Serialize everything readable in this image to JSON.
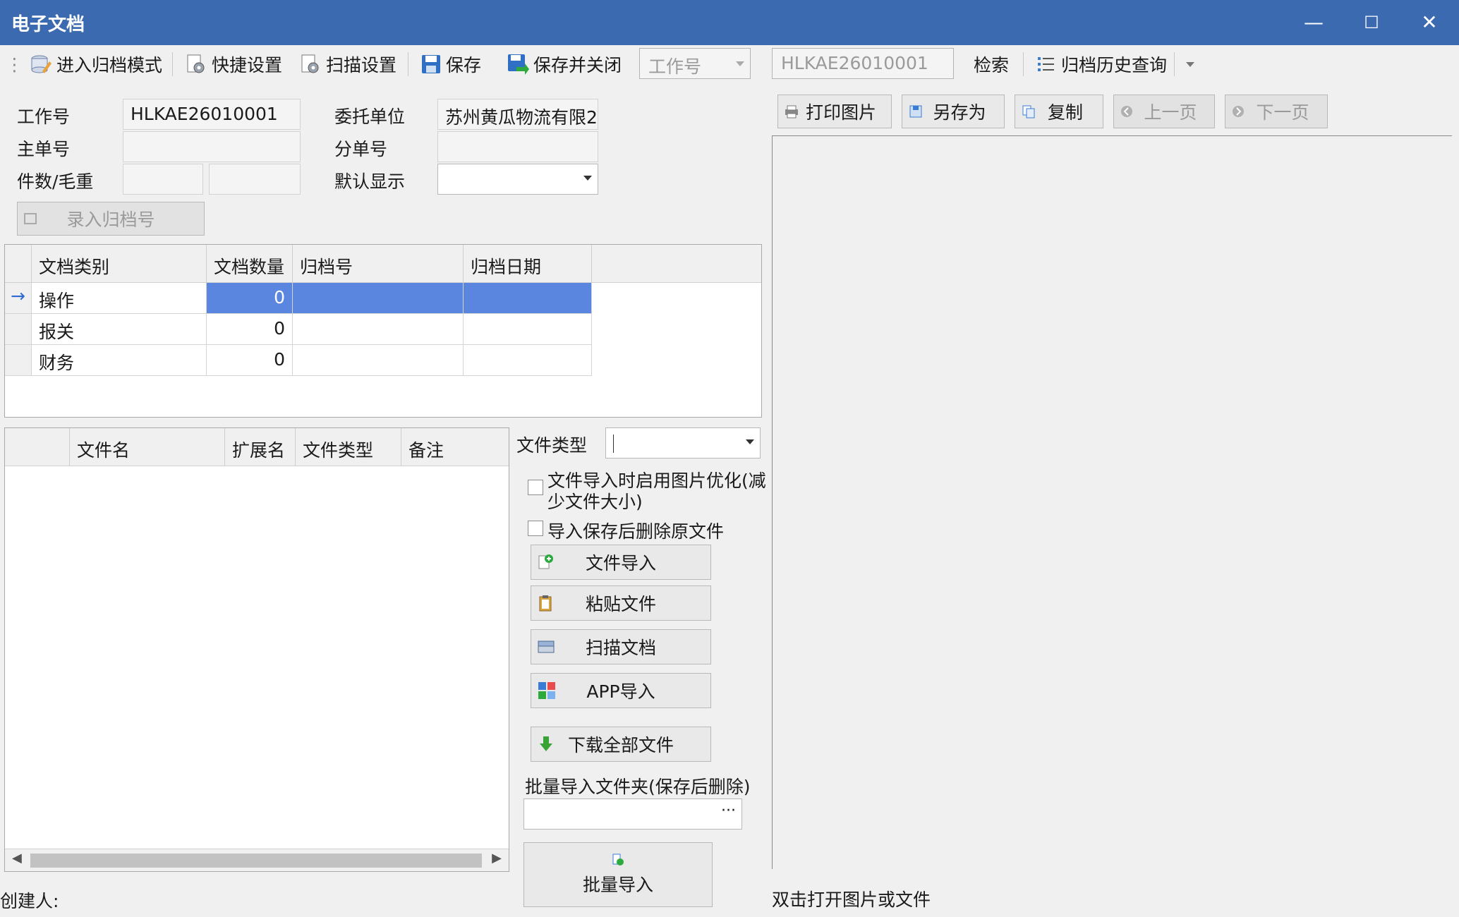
{
  "window": {
    "title": "电子文档",
    "minimize": "—",
    "maximize": "☐",
    "close": "✕"
  },
  "toolbar": {
    "archive_mode": "进入归档模式",
    "quick_settings": "快捷设置",
    "scan_settings": "扫描设置",
    "save": "保存",
    "save_close": "保存并关闭",
    "search_field_placeholder": "工作号",
    "search_value": "HLKAE26010001",
    "search": "检索",
    "archive_history": "归档历史查询"
  },
  "form": {
    "job_no_label": "工作号",
    "job_no_value": "HLKAE26010001",
    "client_label": "委托单位",
    "client_value": "苏州黄瓜物流有限2",
    "master_no_label": "主单号",
    "master_no_value": "",
    "house_no_label": "分单号",
    "house_no_value": "",
    "pieces_weight_label": "件数/毛重",
    "pieces_value": "",
    "weight_value": "",
    "default_display_label": "默认显示",
    "default_display_value": "",
    "enter_archive_button": "录入归档号"
  },
  "doc_grid": {
    "columns": [
      "文档类别",
      "文档数量",
      "归档号",
      "归档日期"
    ],
    "rows": [
      {
        "category": "操作",
        "count": "0",
        "archive_no": "",
        "archive_date": ""
      },
      {
        "category": "报关",
        "count": "0",
        "archive_no": "",
        "archive_date": ""
      },
      {
        "category": "财务",
        "count": "0",
        "archive_no": "",
        "archive_date": ""
      }
    ]
  },
  "file_grid": {
    "columns": [
      "文件名",
      "扩展名",
      "文件类型",
      "备注"
    ]
  },
  "import_panel": {
    "file_type_label": "文件类型",
    "file_type_value": "",
    "optimize_label_line1": "文件导入时启用图片优化(减",
    "optimize_label_line2": "少文件大小)",
    "optimize_checked": false,
    "delete_after_import_label": "导入保存后删除原文件",
    "delete_checked": false,
    "file_import": "文件导入",
    "paste_file": "粘贴文件",
    "scan_doc": "扫描文档",
    "app_import": "APP导入",
    "download_all": "下载全部文件",
    "batch_folder_label": "批量导入文件夹(保存后删除)",
    "batch_folder_value": "",
    "browse": "···",
    "batch_import": "批量导入"
  },
  "viewer": {
    "print_image": "打印图片",
    "save_as": "另存为",
    "copy": "复制",
    "prev_page": "上一页",
    "next_page": "下一页",
    "hint": "双击打开图片或文件"
  },
  "footer": {
    "creator_label": "创建人:"
  },
  "colors": {
    "titlebar": "#3c6ab1",
    "selected_cell": "#5b86e0"
  }
}
